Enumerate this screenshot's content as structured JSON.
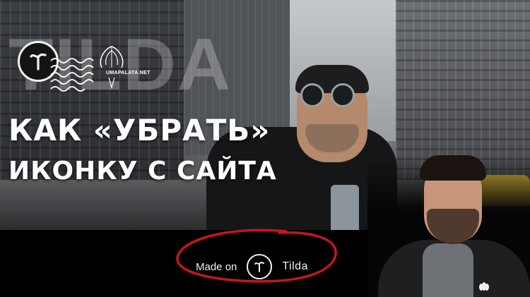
{
  "thumbnail": {
    "wordmark": "TILDA",
    "partner_logo_text": "UMAPALATA.NET",
    "headline_line1": "КАК «УБРАТЬ»",
    "headline_line2": "ИКОНКУ С САЙТА"
  },
  "badge": {
    "prefix": "Made on",
    "brand": "Tilda"
  },
  "icons": {
    "tilda_logo": "tilda-logo-icon",
    "waves": "waves-icon",
    "partner_mark": "umapalata-feather-icon",
    "apparel_logo": "adidas-trefoil-icon"
  },
  "colors": {
    "headline": "#ffffff",
    "highlight_circle": "#c4161c",
    "badge_background": "#000000",
    "badge_text": "#f2f2f2"
  }
}
